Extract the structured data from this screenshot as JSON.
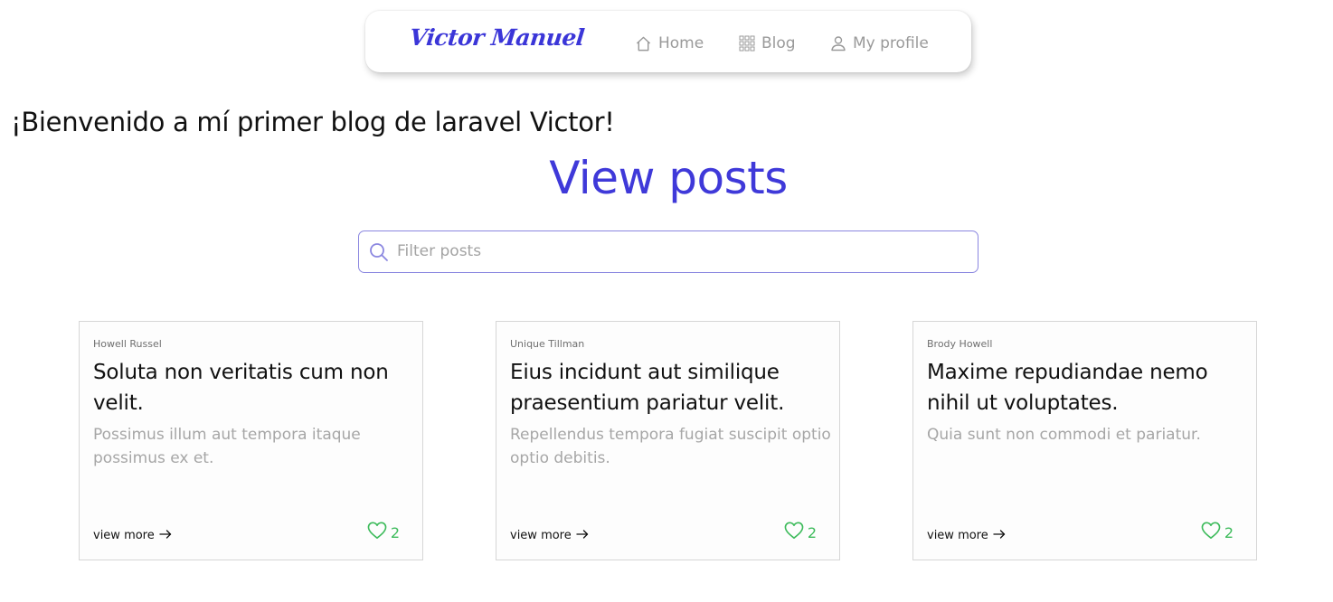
{
  "nav": {
    "brand": "Victor Manuel",
    "items": [
      {
        "label": "Home",
        "icon": "home-icon"
      },
      {
        "label": "Blog",
        "icon": "grid-icon"
      },
      {
        "label": "My profile",
        "icon": "user-icon"
      }
    ]
  },
  "welcome": "¡Bienvenido a mí primer blog de laravel Victor!",
  "heading": "View posts",
  "search": {
    "placeholder": "Filter posts",
    "value": "",
    "icon": "search-icon"
  },
  "posts": [
    {
      "author": "Howell Russel",
      "title": "Soluta non veritatis cum non velit.",
      "body": "Possimus illum aut tempora itaque possimus ex et.",
      "view_more": "view more",
      "likes": "2"
    },
    {
      "author": "Unique Tillman",
      "title": "Eius incidunt aut similique praesentium pariatur velit.",
      "body": "Repellendus tempora fugiat suscipit optio optio debitis.",
      "view_more": "view more",
      "likes": "2"
    },
    {
      "author": "Brody Howell",
      "title": "Maxime repudiandae nemo nihil ut voluptates.",
      "body": "Quia sunt non commodi et pariatur.",
      "view_more": "view more",
      "likes": "2"
    }
  ],
  "colors": {
    "brand": "#3b36d8",
    "heading": "#3f39d9",
    "search_border": "#8b87e0",
    "nav_text": "#9a9a9a",
    "muted_text": "#a6a6a6",
    "like": "#3dbb5b"
  }
}
